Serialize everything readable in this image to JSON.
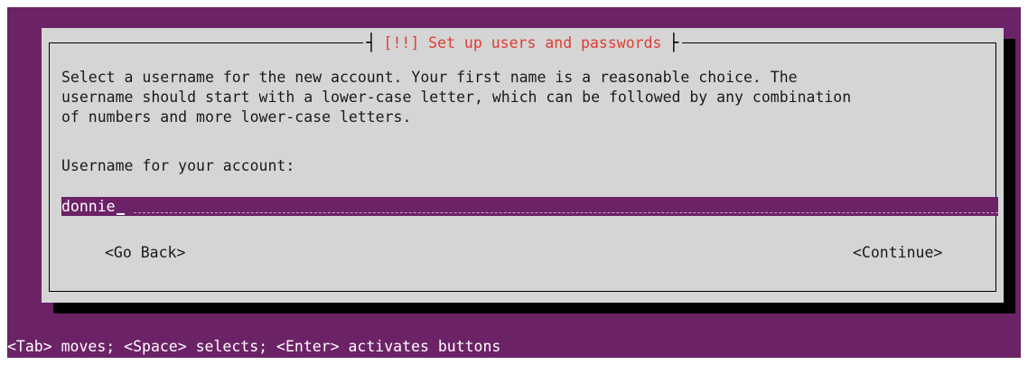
{
  "dialog": {
    "title": "[!!] Set up users and passwords",
    "description_lines": [
      "Select a username for the new account. Your first name is a reasonable choice. The",
      "username should start with a lower-case letter, which can be followed by any combination",
      "of numbers and more lower-case letters."
    ],
    "field_label": "Username for your account:",
    "username_value": "donnie",
    "back_button": "<Go Back>",
    "continue_button": "<Continue>"
  },
  "hint": "<Tab> moves; <Space> selects; <Enter> activates buttons",
  "colors": {
    "screen_background": "#6c2267",
    "dialog_background": "#d5d5d5",
    "title_text": "#e03c31",
    "input_background": "#6c2267",
    "shadow": "#000000"
  }
}
